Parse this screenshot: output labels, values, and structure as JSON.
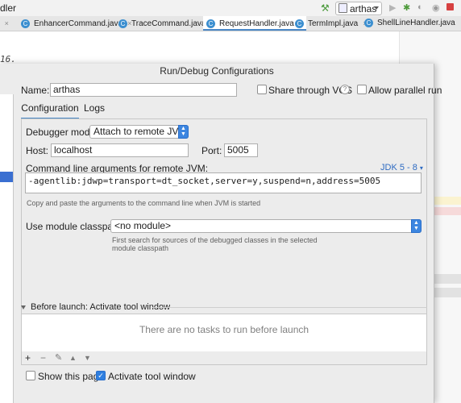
{
  "ide": {
    "title_fragment": "dler",
    "run_config_name": "arthas",
    "code_fragment": "16.",
    "tabs": [
      {
        "label": "EnhancerCommand.java"
      },
      {
        "label": "TraceCommand.java"
      },
      {
        "label": "RequestHandler.java",
        "active": true
      },
      {
        "label": "TermImpl.java"
      },
      {
        "label": "ShellLineHandler.java"
      }
    ]
  },
  "dialog": {
    "title": "Run/Debug Configurations",
    "name_label": "Name:",
    "name_value": "arthas",
    "share_vcs_label": "Share through VCS",
    "allow_parallel_label": "Allow parallel run",
    "tabs": [
      {
        "label": "Configuration",
        "active": true
      },
      {
        "label": "Logs",
        "active": false
      }
    ],
    "debugger_mode_label": "Debugger mode:",
    "debugger_mode_value": "Attach to remote JVM",
    "host_label": "Host:",
    "host_value": "localhost",
    "port_label": "Port:",
    "port_value": "5005",
    "cmdline_label": "Command line arguments for remote JVM:",
    "jdk_link": "JDK 5 - 8",
    "cmdline_value": "-agentlib:jdwp=transport=dt_socket,server=y,suspend=n,address=5005",
    "cmdline_hint": "Copy and paste the arguments to the command line when JVM is started",
    "module_label": "Use module classpath:",
    "module_value": "<no module>",
    "module_hint_line1": "First search for sources of the debugged classes in the selected",
    "module_hint_line2": "module classpath",
    "before_launch_label": "Before launch: Activate tool window",
    "no_tasks_text": "There are no tasks to run before launch",
    "show_page_label": "Show this page",
    "show_page_checked": false,
    "activate_tool_label": "Activate tool window",
    "activate_tool_checked": true,
    "share_vcs_checked": false,
    "allow_parallel_checked": false
  },
  "icons": {
    "add": "+",
    "remove": "−",
    "edit": "✎",
    "up": "▲",
    "down": "▼",
    "help": "?",
    "check": "✓",
    "class": "C",
    "close": "×"
  },
  "colors": {
    "accent": "#3d86e0",
    "selection": "#3a6fd1",
    "link": "#2e6bc2"
  }
}
